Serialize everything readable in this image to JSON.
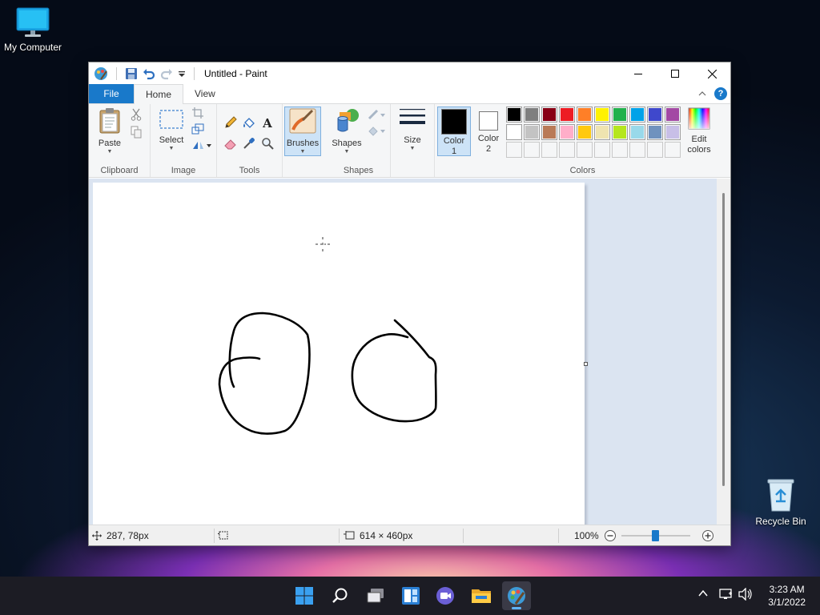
{
  "desktop": {
    "icons": [
      {
        "label": "My Computer"
      },
      {
        "label": "Recycle Bin"
      }
    ]
  },
  "window": {
    "title": "Untitled - Paint",
    "tabs": [
      {
        "label": "File"
      },
      {
        "label": "Home"
      },
      {
        "label": "View"
      }
    ],
    "ribbon": {
      "clipboard": {
        "label": "Clipboard",
        "paste": "Paste"
      },
      "image": {
        "label": "Image",
        "select": "Select"
      },
      "tools": {
        "label": "Tools"
      },
      "brushes": {
        "label": "Brushes"
      },
      "shapes": {
        "label": "Shapes",
        "shapes_btn": "Shapes"
      },
      "size": {
        "label": "Size"
      },
      "colors": {
        "label": "Colors",
        "color1": "Color\n1",
        "color1_line1": "Color",
        "color1_line2": "1",
        "color2_line1": "Color",
        "color2_line2": "2",
        "edit_line1": "Edit",
        "edit_line2": "colors",
        "color1_value": "#000000",
        "color2_value": "#ffffff",
        "palette_row1": [
          "#000000",
          "#7f7f7f",
          "#880015",
          "#ed1c24",
          "#ff7f27",
          "#fff200",
          "#22b14c",
          "#00a2e8",
          "#3f48cc",
          "#a349a4"
        ],
        "palette_row2": [
          "#ffffff",
          "#c3c3c3",
          "#b97a57",
          "#ffaec9",
          "#ffc90e",
          "#efe4b0",
          "#b5e61d",
          "#99d9ea",
          "#7092be",
          "#c8bfe7"
        ]
      }
    },
    "statusbar": {
      "cursor_pos": "287, 78px",
      "canvas_size": "614 × 460px",
      "zoom": "100%",
      "zoom_level": 0.5
    }
  },
  "taskbar": {
    "time": "3:23 AM",
    "date": "3/1/2022"
  },
  "colors": {
    "accent": "#1979ca",
    "taskbar": "#1c1c24",
    "workspace": "#dbe4f1"
  }
}
